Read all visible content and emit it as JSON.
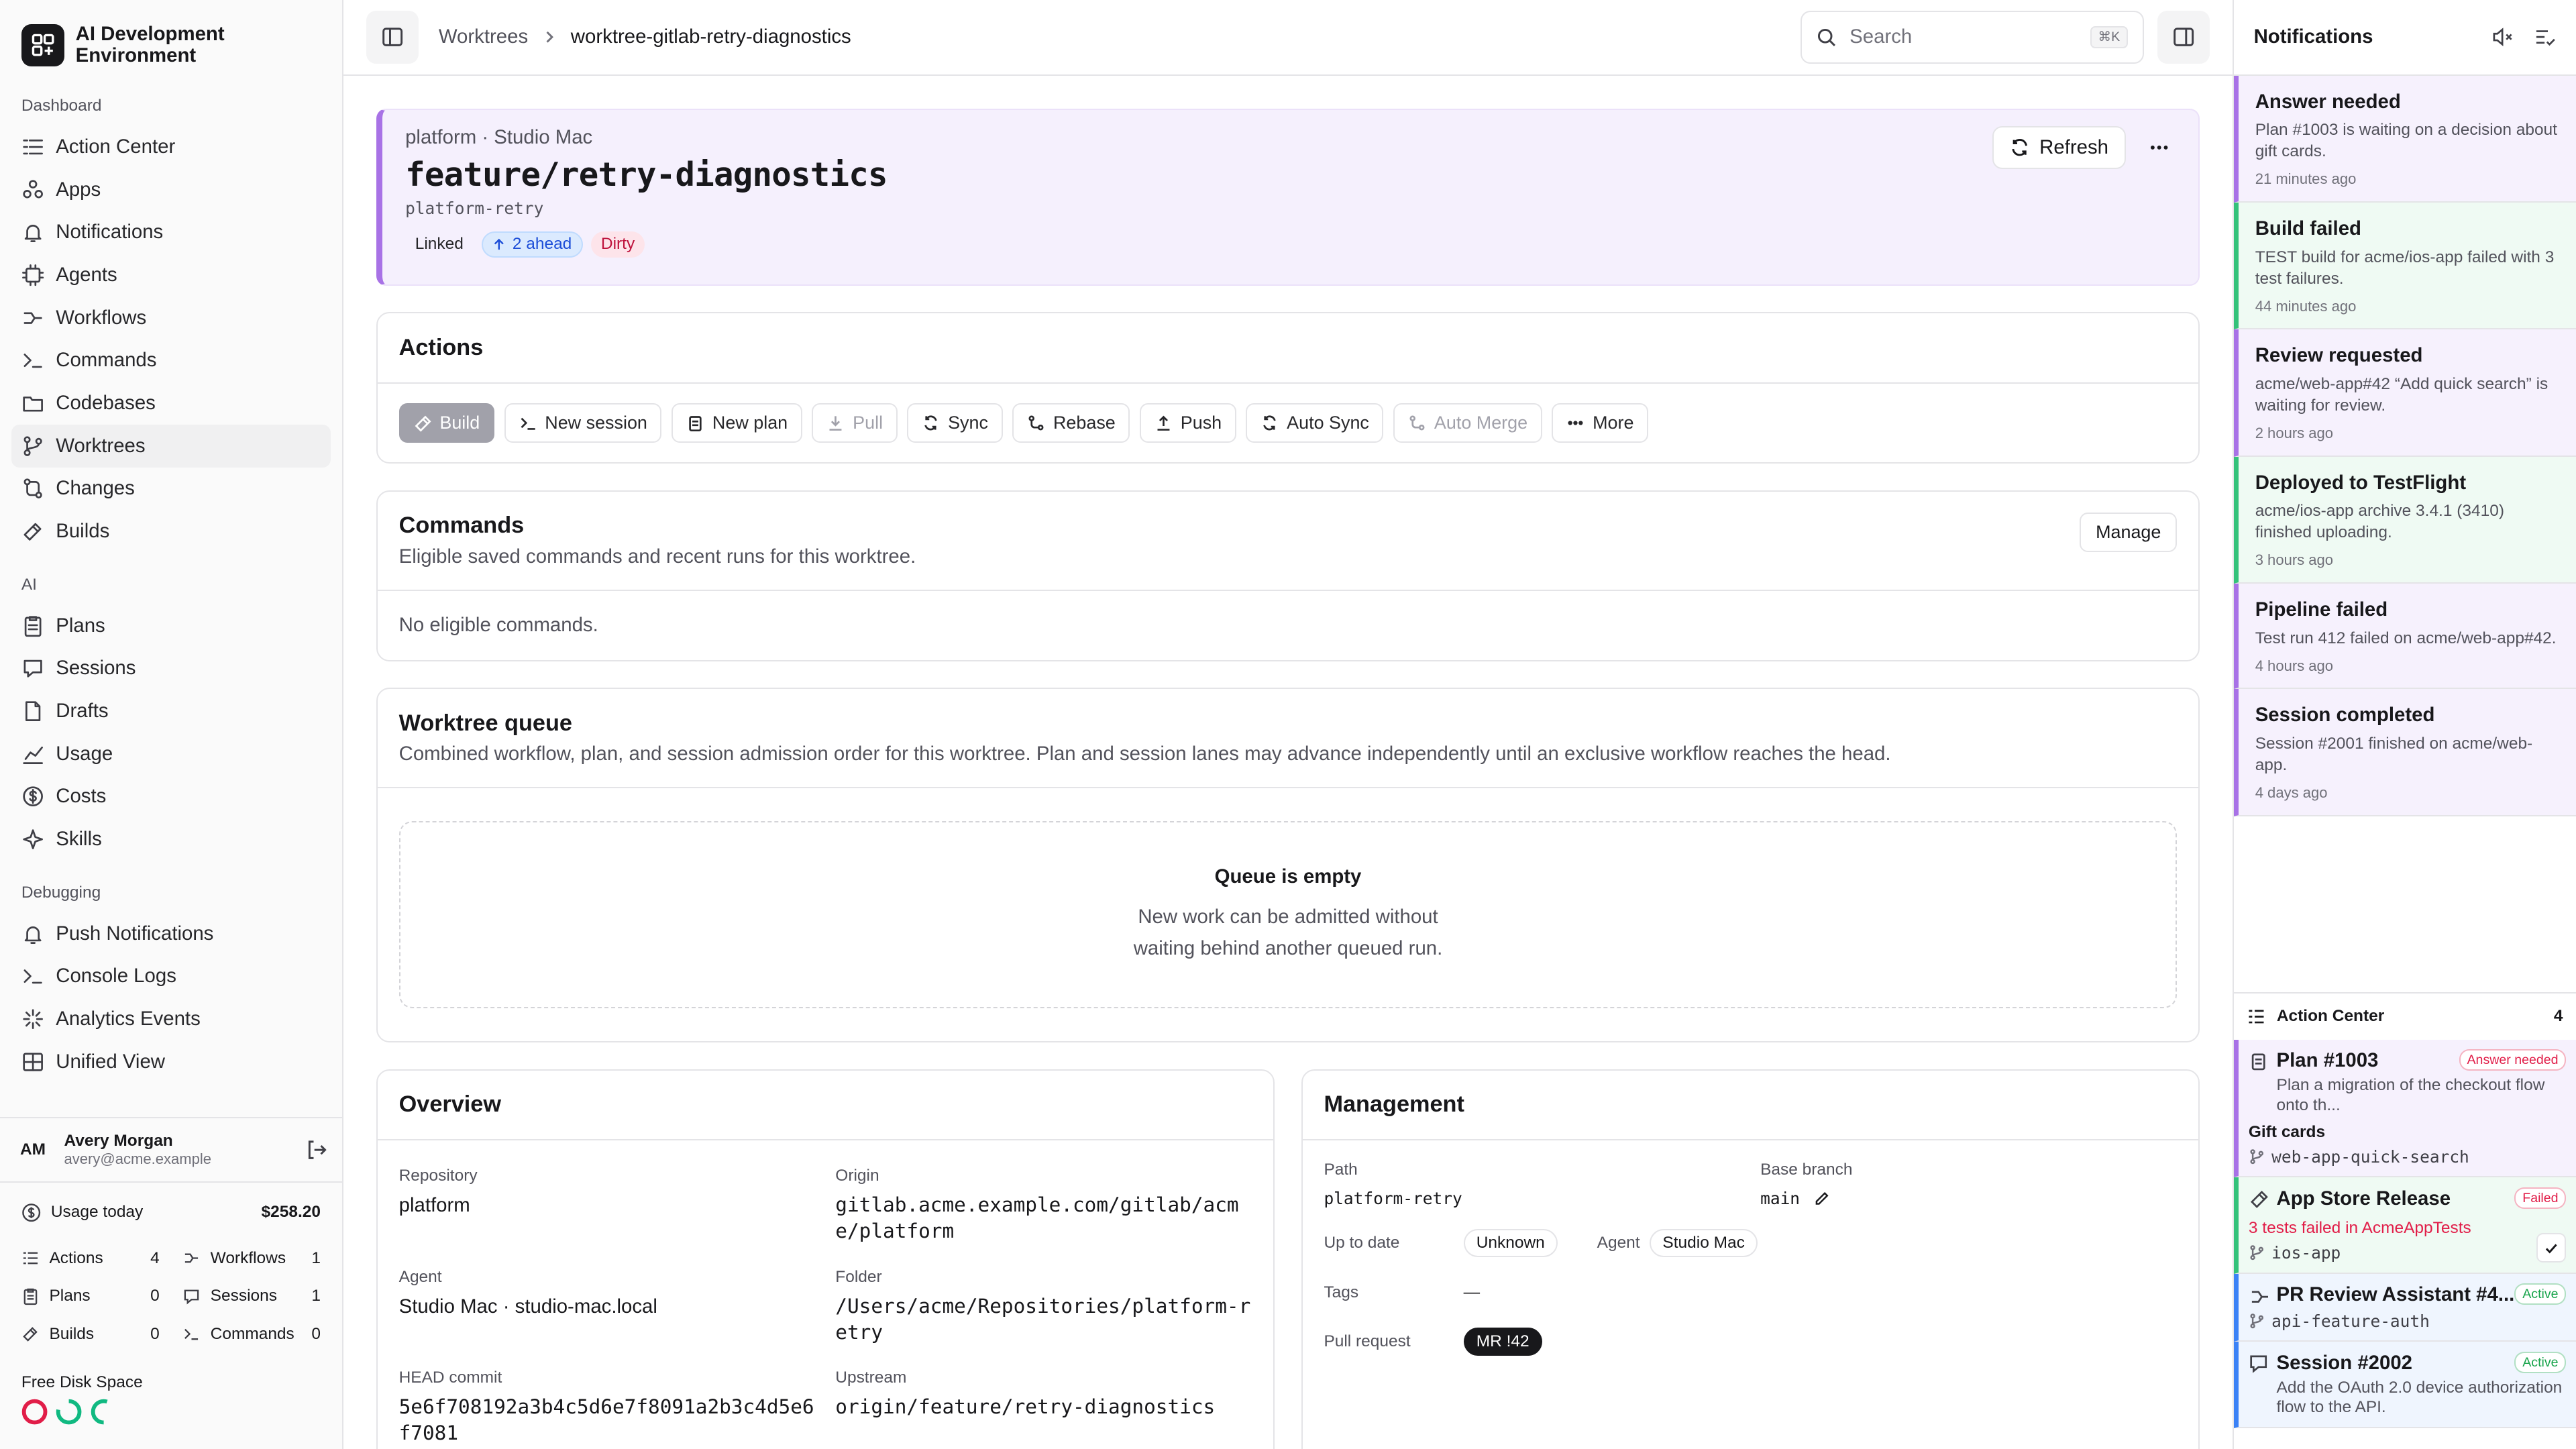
{
  "brand": {
    "name": "AI Development Environment"
  },
  "sidebar": {
    "sections": [
      {
        "title": "Dashboard",
        "items": [
          "Action Center",
          "Apps",
          "Notifications",
          "Agents",
          "Workflows",
          "Commands",
          "Codebases",
          "Worktrees",
          "Changes",
          "Builds"
        ]
      },
      {
        "title": "AI",
        "items": [
          "Plans",
          "Sessions",
          "Drafts",
          "Usage",
          "Costs",
          "Skills"
        ]
      },
      {
        "title": "Debugging",
        "items": [
          "Push Notifications",
          "Console Logs",
          "Analytics Events",
          "Unified View"
        ]
      }
    ],
    "active": "Worktrees"
  },
  "user": {
    "initials": "AM",
    "name": "Avery Morgan",
    "email": "avery@acme.example"
  },
  "usage": {
    "label": "Usage today",
    "amount": "$258.20",
    "stats": [
      {
        "label": "Actions",
        "n": "4"
      },
      {
        "label": "Workflows",
        "n": "1"
      },
      {
        "label": "Plans",
        "n": "0"
      },
      {
        "label": "Sessions",
        "n": "1"
      },
      {
        "label": "Builds",
        "n": "0"
      },
      {
        "label": "Commands",
        "n": "0"
      }
    ],
    "disk_label": "Free Disk Space",
    "disk_colors": [
      "#e11d48",
      "#10b981",
      "#10b981"
    ]
  },
  "topbar": {
    "crumb1": "Worktrees",
    "crumb2": "worktree-gitlab-retry-diagnostics",
    "search_placeholder": "Search",
    "search_kbd": "⌘K"
  },
  "hero": {
    "meta": "platform · Studio Mac",
    "branch": "feature/retry-diagnostics",
    "sub": "platform-retry",
    "linked": "Linked",
    "ahead": "2 ahead",
    "dirty": "Dirty",
    "refresh": "Refresh"
  },
  "actions": {
    "title": "Actions",
    "buttons": [
      {
        "label": "Build",
        "state": "primary"
      },
      {
        "label": "New session",
        "state": "normal"
      },
      {
        "label": "New plan",
        "state": "normal"
      },
      {
        "label": "Pull",
        "state": "disabled"
      },
      {
        "label": "Sync",
        "state": "normal"
      },
      {
        "label": "Rebase",
        "state": "normal"
      },
      {
        "label": "Push",
        "state": "normal"
      },
      {
        "label": "Auto Sync",
        "state": "normal"
      },
      {
        "label": "Auto Merge",
        "state": "disabled"
      },
      {
        "label": "More",
        "state": "normal"
      }
    ]
  },
  "commands": {
    "title": "Commands",
    "desc": "Eligible saved commands and recent runs for this worktree.",
    "manage": "Manage",
    "empty": "No eligible commands."
  },
  "queue": {
    "title": "Worktree queue",
    "desc": "Combined workflow, plan, and session admission order for this worktree. Plan and session lanes may advance independently until an exclusive workflow reaches the head.",
    "empty_title": "Queue is empty",
    "empty_desc": "New work can be admitted without waiting behind another queued run."
  },
  "overview": {
    "title": "Overview",
    "fields": [
      {
        "k": "Repository",
        "v": "platform",
        "mono": false
      },
      {
        "k": "Origin",
        "v": "gitlab.acme.example.com/gitlab/acme/platform",
        "mono": true
      },
      {
        "k": "Agent",
        "v": "Studio Mac · studio-mac.local",
        "mono": false
      },
      {
        "k": "Folder",
        "v": "/Users/acme/Repositories/platform-retry",
        "mono": true
      },
      {
        "k": "HEAD commit",
        "v": "5e6f708192a3b4c5d6e7f8091a2b3c4d5e6f7081",
        "mono": true
      },
      {
        "k": "Upstream",
        "v": "origin/feature/retry-diagnostics",
        "mono": true
      }
    ]
  },
  "management": {
    "title": "Management",
    "path_label": "Path",
    "path": "platform-retry",
    "base_label": "Base branch",
    "base": "main",
    "uptodate_label": "Up to date",
    "uptodate": "Unknown",
    "agent_label": "Agent",
    "agent": "Studio Mac",
    "tags_label": "Tags",
    "tags": "—",
    "pr_label": "Pull request",
    "pr": "MR !42"
  },
  "notifications": {
    "title": "Notifications",
    "items": [
      {
        "title": "Answer needed",
        "desc": "Plan #1003 is waiting on a decision about gift cards.",
        "when": "21 minutes ago",
        "color": "#a872e6",
        "bg": "#f6f1fd"
      },
      {
        "title": "Build failed",
        "desc": "TEST build for acme/ios-app failed with 3 test failures.",
        "when": "44 minutes ago",
        "color": "#34c27a",
        "bg": "#effaf3"
      },
      {
        "title": "Review requested",
        "desc": "acme/web-app#42 “Add quick search” is waiting for review.",
        "when": "2 hours ago",
        "color": "#a872e6",
        "bg": "#f6f1fd"
      },
      {
        "title": "Deployed to TestFlight",
        "desc": "acme/ios-app archive 3.4.1 (3410) finished uploading.",
        "when": "3 hours ago",
        "color": "#34c27a",
        "bg": "#effaf3"
      },
      {
        "title": "Pipeline failed",
        "desc": "Test run 412 failed on acme/web-app#42.",
        "when": "4 hours ago",
        "color": "#a872e6",
        "bg": "#f6f1fd"
      },
      {
        "title": "Session completed",
        "desc": "Session #2001 finished on acme/web-app.",
        "when": "4 days ago",
        "color": "#a872e6",
        "bg": "#f6f1fd"
      }
    ]
  },
  "action_center": {
    "title": "Action Center",
    "count": "4",
    "items": [
      {
        "title": "Plan #1003",
        "tag": "Answer needed",
        "desc": "Plan a migration of the checkout flow onto th...",
        "extra": "Gift cards",
        "ref": "web-app-quick-search",
        "color": "#a872e6",
        "bg": "#f6f1fd",
        "tagcolor": "#e11d48"
      },
      {
        "title": "App Store Release",
        "tag": "Failed",
        "desc": "3 tests failed in AcmeAppTests",
        "extra": "",
        "ref": "ios-app",
        "color": "#34c27a",
        "bg": "#effaf3",
        "tagcolor": "#e11d48"
      },
      {
        "title": "PR Review Assistant #4...",
        "tag": "Active",
        "desc": "",
        "extra": "",
        "ref": "api-feature-auth",
        "color": "#3b82f6",
        "bg": "#eff5fe",
        "tagcolor": "#16a34a"
      },
      {
        "title": "Session #2002",
        "tag": "Active",
        "desc": "Add the OAuth 2.0 device authorization flow to the API.",
        "extra": "",
        "ref": "",
        "color": "#3b82f6",
        "bg": "#eff5fe",
        "tagcolor": "#16a34a"
      }
    ]
  }
}
